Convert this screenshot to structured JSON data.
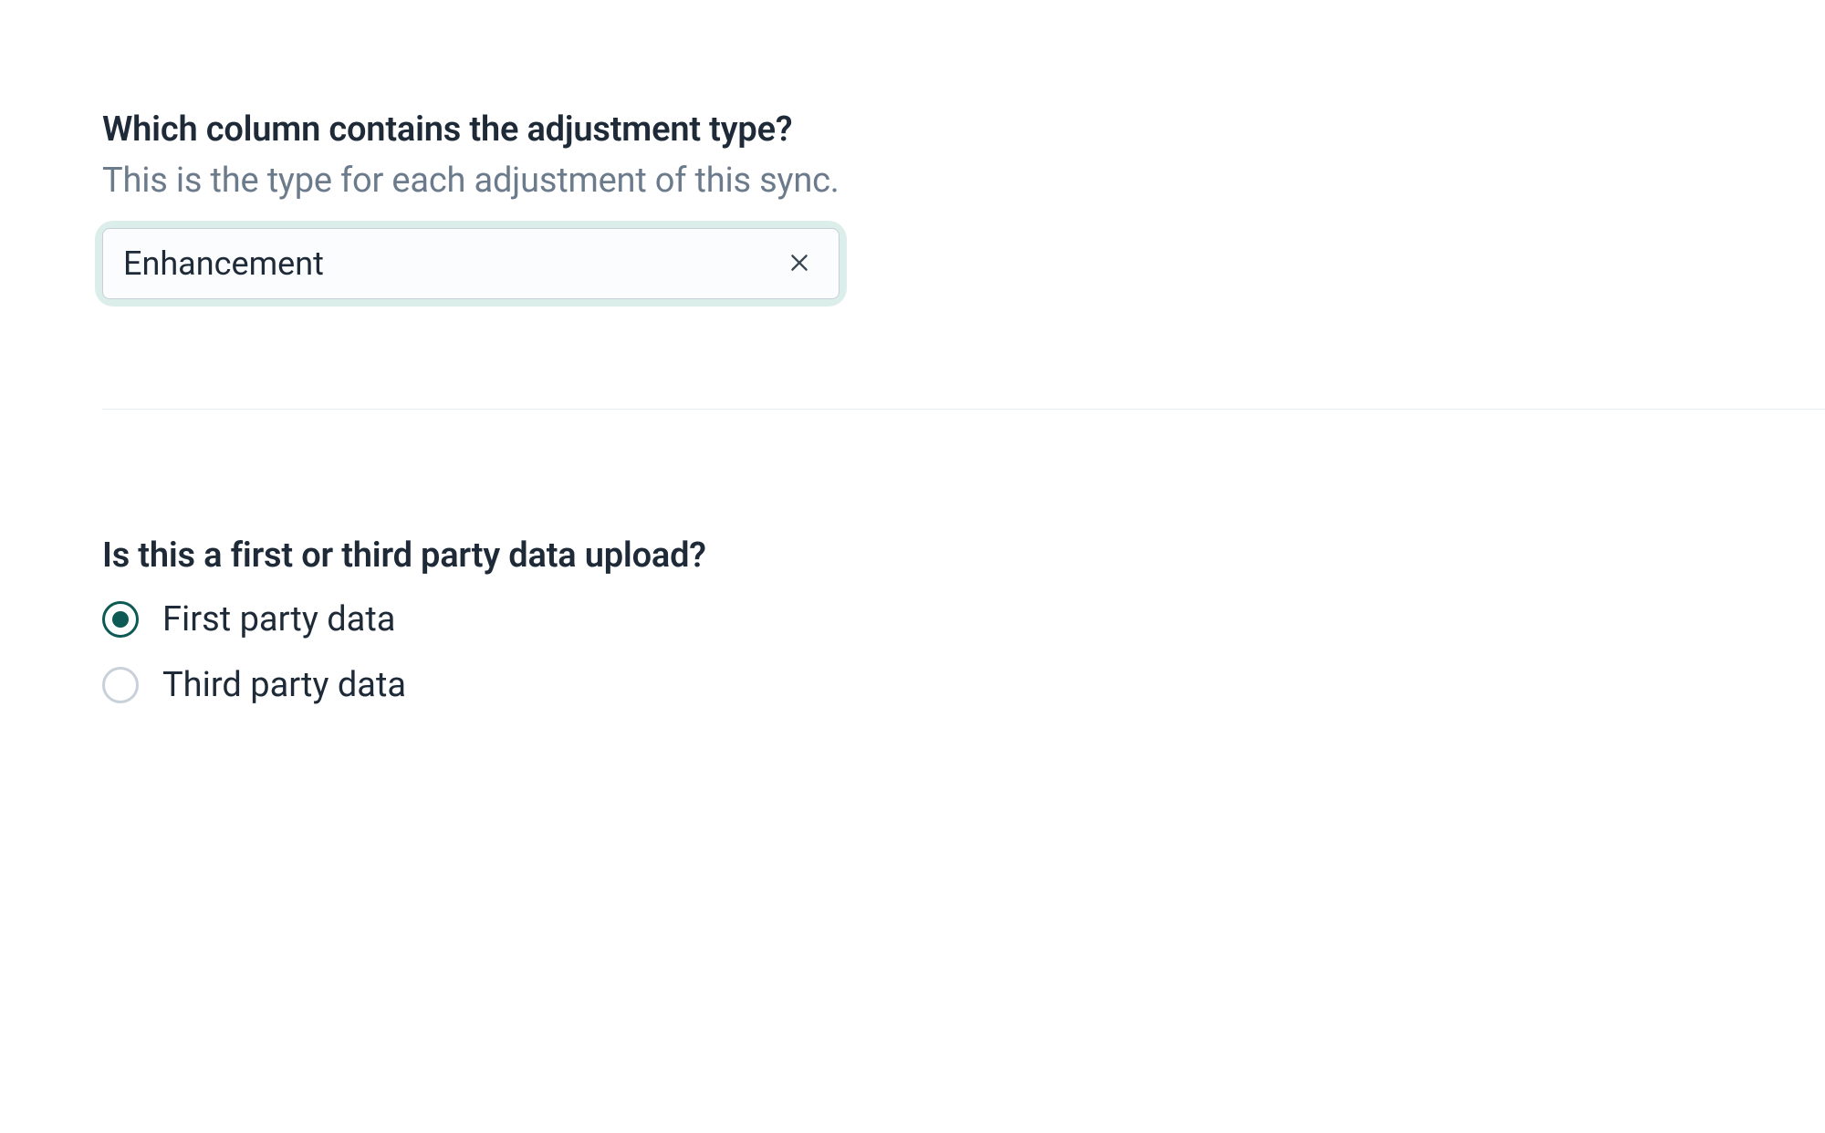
{
  "adjustment_type": {
    "question": "Which column contains the adjustment type?",
    "description": "This is the type for each adjustment of this sync.",
    "selected_value": "Enhancement"
  },
  "data_upload": {
    "question": "Is this a first or third party data upload?",
    "options": [
      {
        "label": "First party data",
        "selected": true
      },
      {
        "label": "Third party data",
        "selected": false
      }
    ]
  }
}
